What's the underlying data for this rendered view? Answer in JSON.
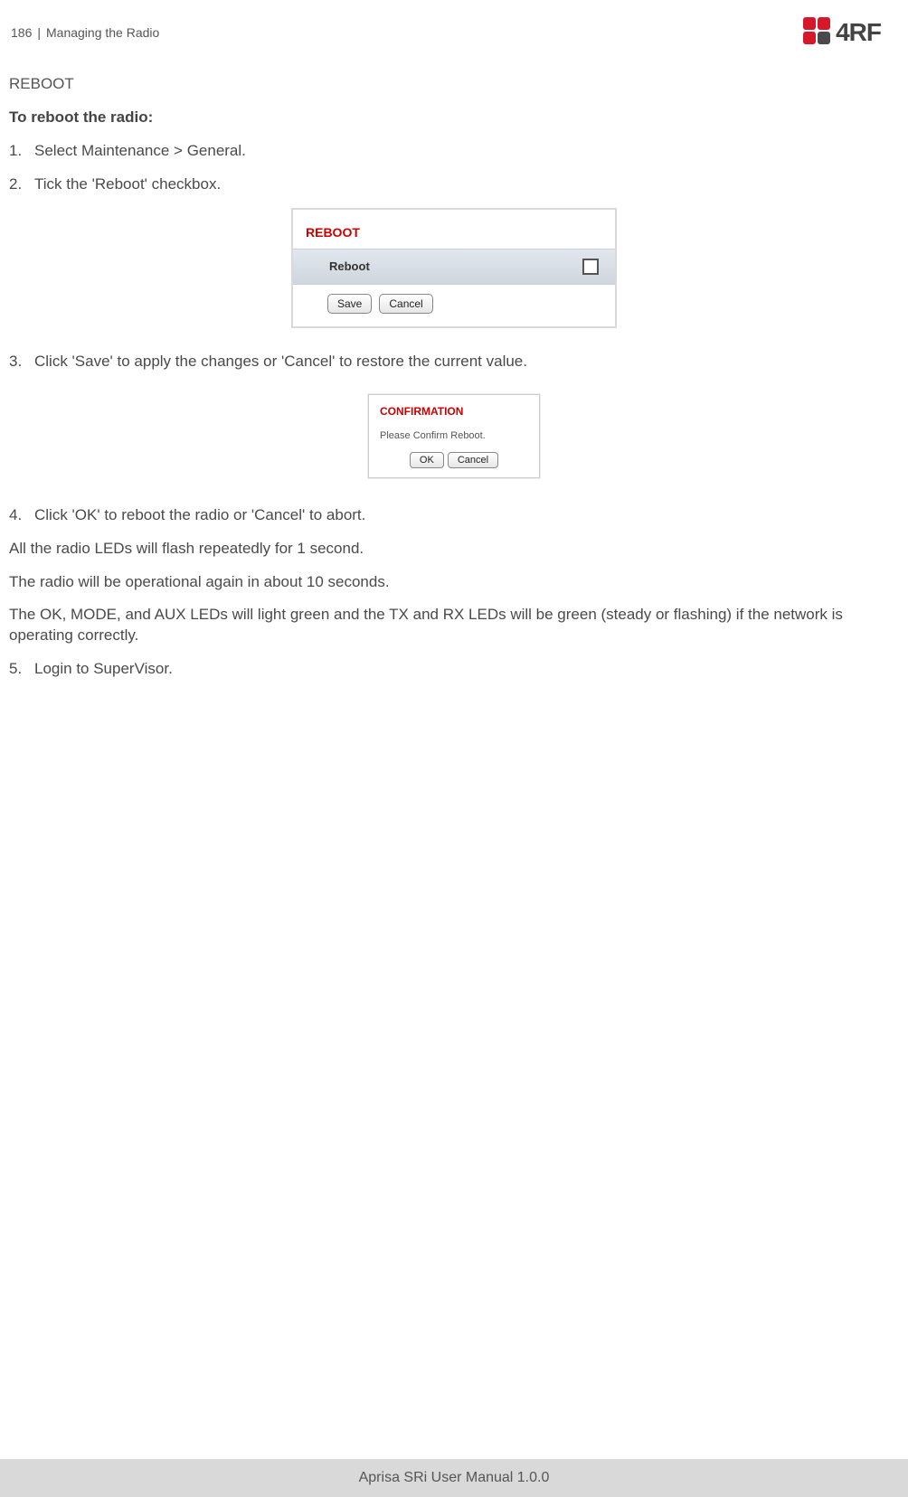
{
  "header": {
    "page_number": "186",
    "sep": "|",
    "section": "Managing the Radio",
    "logo_text": "4RF"
  },
  "body": {
    "h_section": "REBOOT",
    "intro_bold": "To reboot the radio:",
    "step1_n": "1.",
    "step1": "Select Maintenance > General.",
    "step2_n": "2.",
    "step2": "Tick the 'Reboot' checkbox.",
    "step3_n": "3.",
    "step3": "Click 'Save' to apply the changes or 'Cancel' to restore the current value.",
    "step4_n": "4.",
    "step4": "Click 'OK' to reboot the radio or 'Cancel' to abort.",
    "para_a": "All the radio LEDs will flash repeatedly for 1 second.",
    "para_b": "The radio will be operational again in about 10 seconds.",
    "para_c": "The OK, MODE, and AUX LEDs will light green and the TX and RX LEDs will be green (steady or flashing) if the network is operating correctly.",
    "step5_n": "5.",
    "step5": "Login to SuperVisor."
  },
  "reboot_panel": {
    "title": "REBOOT",
    "field_label": "Reboot",
    "save": "Save",
    "cancel": "Cancel"
  },
  "confirm_panel": {
    "title": "CONFIRMATION",
    "msg": "Please Confirm Reboot.",
    "ok": "OK",
    "cancel": "Cancel"
  },
  "footer": {
    "text": "Aprisa SRi User Manual 1.0.0"
  }
}
